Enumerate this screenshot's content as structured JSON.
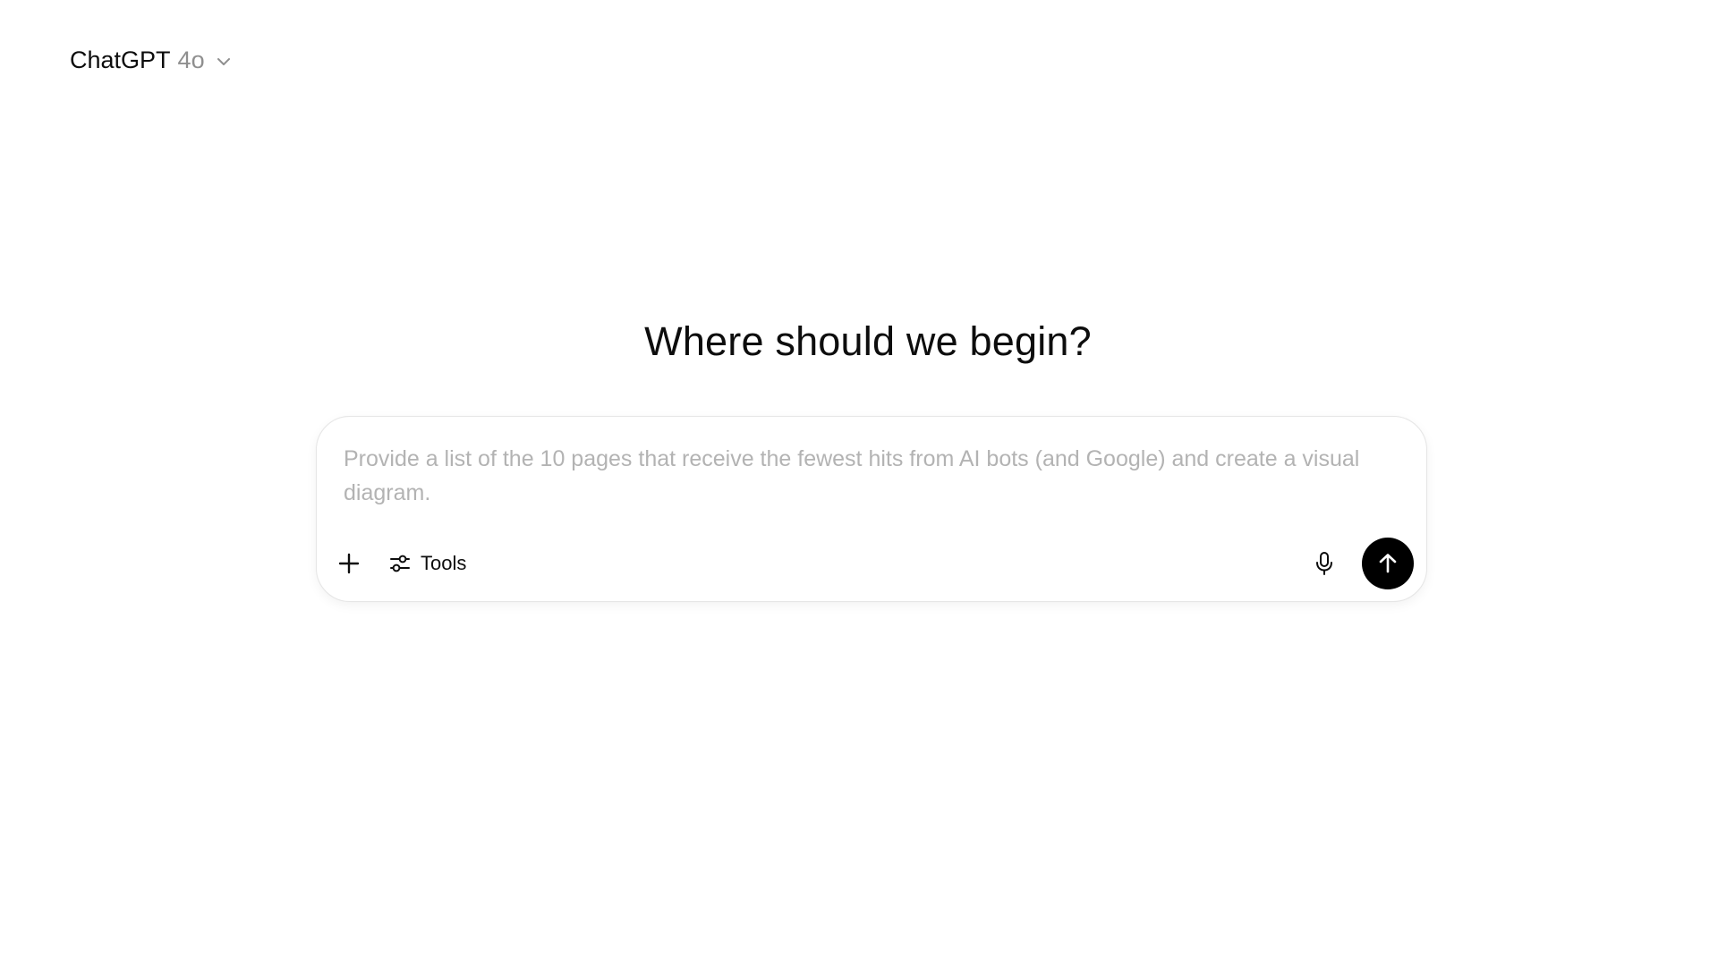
{
  "header": {
    "model_name": "ChatGPT",
    "model_version": "4o",
    "chevron_icon": "chevron-down-icon"
  },
  "main": {
    "headline": "Where should we begin?"
  },
  "composer": {
    "placeholder": "Provide a list of the 10 pages that receive the fewest hits from AI bots (and Google) and create a visual diagram.",
    "value": "",
    "plus_icon": "plus-icon",
    "tools_icon": "sliders-icon",
    "tools_label": "Tools",
    "mic_icon": "microphone-icon",
    "send_icon": "arrow-up-icon"
  },
  "colors": {
    "background": "#ffffff",
    "text": "#0d0d0d",
    "muted_text": "#8f8f8f",
    "placeholder": "#b3b3b3",
    "send_button": "#000000",
    "border": "#e6e6e6"
  }
}
